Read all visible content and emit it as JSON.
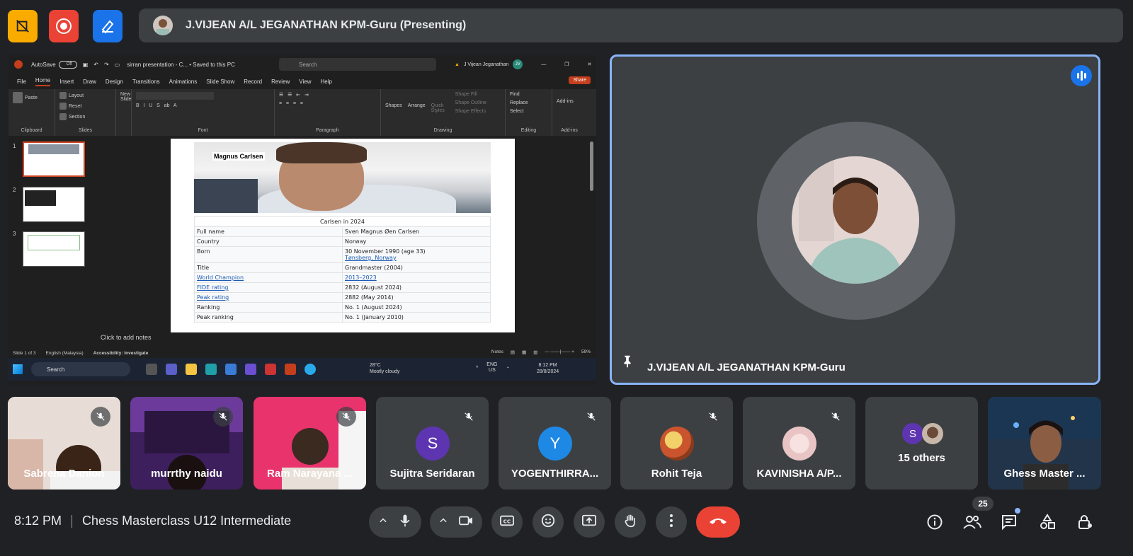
{
  "top": {
    "presenter_label": "J.VIJEAN A/L JEGANATHAN KPM-Guru (Presenting)",
    "buttons": [
      {
        "name": "no-video-tools-icon",
        "color": "#f9ab00"
      },
      {
        "name": "record-icon",
        "color": "#ea4335"
      },
      {
        "name": "whiteboard-icon",
        "color": "#1a73e8"
      }
    ]
  },
  "powerpoint": {
    "autosave": "AutoSave",
    "autosave_state": "Off",
    "doc_title": "sirran presentation - C... • Saved to this PC",
    "search_placeholder": "Search",
    "user_name": "J Vijean Jeganathan",
    "user_initials": "JV",
    "tabs": [
      "File",
      "Home",
      "Insert",
      "Draw",
      "Design",
      "Transitions",
      "Animations",
      "Slide Show",
      "Record",
      "Review",
      "View",
      "Help"
    ],
    "active_tab": "Home",
    "share_label": "Share",
    "ribbon": {
      "clipboard": "Clipboard",
      "paste": "Paste",
      "slides": "Slides",
      "new_slide": "New Slide",
      "layout": "Layout",
      "reset": "Reset",
      "section": "Section",
      "font": "Font",
      "paragraph": "Paragraph",
      "drawing": "Drawing",
      "shapes": "Shapes",
      "arrange": "Arrange",
      "quick_styles": "Quick Styles",
      "shape_fill": "Shape Fill",
      "shape_outline": "Shape Outline",
      "shape_effects": "Shape Effects",
      "editing": "Editing",
      "find": "Find",
      "replace": "Replace",
      "select": "Select",
      "addins": "Add-ins",
      "addins_group": "Add-ins"
    },
    "slide_numbers": [
      "1",
      "2",
      "3"
    ],
    "slide": {
      "photo_caption": "Magnus Carlsen",
      "table_caption": "Carlsen in 2024",
      "rows": [
        {
          "label": "Full name",
          "value": "Sven Magnus Øen Carlsen",
          "label_link": false
        },
        {
          "label": "Country",
          "value": "Norway",
          "label_link": false
        },
        {
          "label": "Born",
          "value": "30 November 1990 (age 33)",
          "value2": "Tønsberg, Norway",
          "label_link": false
        },
        {
          "label": "Title",
          "value": "Grandmaster (2004)",
          "label_link": false
        },
        {
          "label": "World Champion",
          "value": "2013–2023",
          "label_link": true
        },
        {
          "label": "FIDE rating",
          "value": "2832 (August 2024)",
          "label_link": true
        },
        {
          "label": "Peak rating",
          "value": "2882 (May 2014)",
          "label_link": true
        },
        {
          "label": "Ranking",
          "value": "No. 1 (August 2024)",
          "label_link": false
        },
        {
          "label": "Peak ranking",
          "value": "No. 1 (January 2010)",
          "label_link": false
        }
      ]
    },
    "notes_placeholder": "Click to add notes",
    "status": {
      "slide_of": "Slide 1 of 3",
      "language": "English (Malaysia)",
      "accessibility": "Accessibility: Investigate",
      "notes": "Notes",
      "zoom": "59%"
    }
  },
  "taskbar": {
    "search": "Search",
    "temp": "28°C",
    "weather": "Mostly cloudy",
    "lang": "ENG",
    "region": "US",
    "time": "8:12 PM",
    "date": "28/8/2024"
  },
  "speaker": {
    "name": "J.VIJEAN A/L JEGANATHAN KPM-Guru"
  },
  "participants": [
    {
      "name": "Sabrena Danion",
      "type": "video",
      "bg": "#e8dcd6"
    },
    {
      "name": "murrthy naidu",
      "type": "video",
      "bg": "#5a2a7a"
    },
    {
      "name": "Ram Narayana ...",
      "type": "video",
      "bg": "#e8336d"
    },
    {
      "name": "Sujitra Seridaran",
      "type": "letter",
      "letter": "S",
      "color": "#5e35b1"
    },
    {
      "name": "YOGENTHIRRA...",
      "type": "letter",
      "letter": "Y",
      "color": "#1e88e5"
    },
    {
      "name": "Rohit Teja",
      "type": "pic",
      "color": "#d4a23a"
    },
    {
      "name": "KAVINISHA A/P...",
      "type": "pic",
      "color": "#f0d4d4"
    },
    {
      "name": "15 others",
      "type": "others",
      "letter": "S",
      "color": "#5e35b1"
    },
    {
      "name": "Ghess Master ...",
      "type": "video",
      "bg": "#1c3b5a"
    }
  ],
  "bottom": {
    "time": "8:12 PM",
    "meeting_title": "Chess Masterclass U12 Intermediate",
    "participant_count": "25",
    "end_call_color": "#ea4335"
  }
}
